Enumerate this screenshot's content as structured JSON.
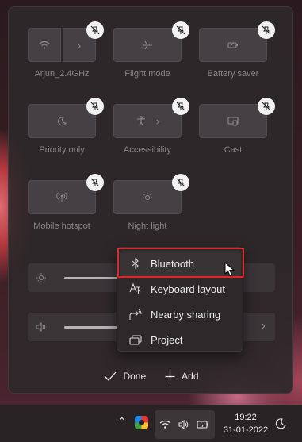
{
  "tiles": [
    {
      "label": "Arjun_2.4GHz",
      "icon": "wifi-icon",
      "has_arrow": true
    },
    {
      "label": "Flight mode",
      "icon": "airplane-icon"
    },
    {
      "label": "Battery saver",
      "icon": "battery-saver-icon"
    },
    {
      "label": "Priority only",
      "icon": "moon-icon"
    },
    {
      "label": "Accessibility",
      "icon": "accessibility-icon",
      "has_arrow": true
    },
    {
      "label": "Cast",
      "icon": "cast-icon"
    },
    {
      "label": "Mobile hotspot",
      "icon": "hotspot-icon"
    },
    {
      "label": "Night light",
      "icon": "night-light-icon"
    }
  ],
  "sliders": {
    "brightness_level": 0.55,
    "volume_level": 0.5
  },
  "menu": {
    "items": [
      {
        "label": "Bluetooth",
        "icon": "bluetooth-icon"
      },
      {
        "label": "Keyboard layout",
        "icon": "keyboard-layout-icon"
      },
      {
        "label": "Nearby sharing",
        "icon": "nearby-sharing-icon"
      },
      {
        "label": "Project",
        "icon": "project-icon"
      }
    ]
  },
  "footer": {
    "done_label": "Done",
    "add_label": "Add"
  },
  "taskbar": {
    "time": "19:22",
    "date": "31-01-2022"
  },
  "colors": {
    "highlight": "#e0262b",
    "panel": "#2e282a"
  }
}
